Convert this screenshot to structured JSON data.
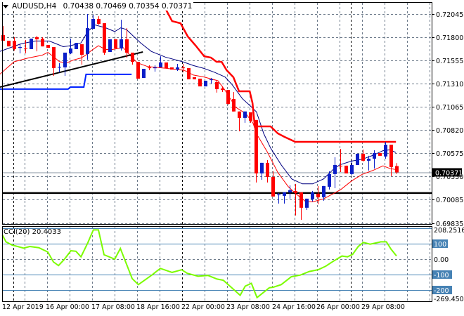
{
  "header": {
    "symbol": "AUDUSD,H4",
    "open": "0.70438",
    "high": "0.70469",
    "low": "0.70354",
    "close": "0.70371"
  },
  "colors": {
    "bull": "#0A1EC8",
    "bear": "#FF0000",
    "ma_upper": "#000080",
    "ma_lower": "#FF0000",
    "resistance": "#FF0000",
    "support": "#0022FF",
    "trendline": "#000000",
    "cci": "#7CFC00",
    "cci_levels": "#4682B4",
    "grid": "#6E7B8B"
  },
  "chart_data": [
    {
      "type": "candlestick",
      "title": "AUDUSD,H4",
      "ylim": [
        0.69835,
        0.7227
      ],
      "y_ticks": [
        "0.72045",
        "0.71800",
        "0.71555",
        "0.71310",
        "0.71065",
        "0.70820",
        "0.70575",
        "0.70330",
        "0.70085",
        "0.69835"
      ],
      "current_price": "0.70371",
      "x_labels": [
        "12 Apr 2019",
        "16 Apr 00:00",
        "17 Apr 08:00",
        "18 Apr 16:00",
        "22 Apr 00:00",
        "23 Apr 08:00",
        "24 Apr 16:00",
        "26 Apr 00:00",
        "29 Apr 08:00"
      ],
      "candles_ohlc": [
        [
          0.71822,
          0.71918,
          0.71763,
          0.71763
        ],
        [
          0.71763,
          0.71763,
          0.71703,
          0.71703
        ],
        [
          0.71763,
          0.718,
          0.71659,
          0.71674
        ],
        [
          0.71688,
          0.71726,
          0.71629,
          0.71696
        ],
        [
          0.71688,
          0.7177,
          0.71629,
          0.71681
        ],
        [
          0.71674,
          0.71785,
          0.71674,
          0.71785
        ],
        [
          0.718,
          0.71815,
          0.71651,
          0.71778
        ],
        [
          0.71785,
          0.718,
          0.71703,
          0.71703
        ],
        [
          0.71718,
          0.71718,
          0.71688,
          0.71688
        ],
        [
          0.71696,
          0.71696,
          0.71392,
          0.71473
        ],
        [
          0.71481,
          0.71525,
          0.71429,
          0.71488
        ],
        [
          0.71481,
          0.71637,
          0.71392,
          0.71637
        ],
        [
          0.71629,
          0.71785,
          0.71622,
          0.71681
        ],
        [
          0.71674,
          0.7174,
          0.71674,
          0.7174
        ],
        [
          0.71726,
          0.71726,
          0.7151,
          0.71614
        ],
        [
          0.71622,
          0.72045,
          0.71562,
          0.71896
        ],
        [
          0.71889,
          0.72037,
          0.71889,
          0.71993
        ],
        [
          0.71993,
          0.72022,
          0.71933,
          0.71941
        ],
        [
          0.71948,
          0.71948,
          0.71614,
          0.71637
        ],
        [
          0.71644,
          0.71778,
          0.71644,
          0.71778
        ],
        [
          0.71778,
          0.71778,
          0.71681,
          0.71681
        ],
        [
          0.71681,
          0.71985,
          0.71659,
          0.71778
        ],
        [
          0.71778,
          0.71896,
          0.71585,
          0.71637
        ],
        [
          0.71637,
          0.71637,
          0.7151,
          0.7154
        ],
        [
          0.7154,
          0.7154,
          0.71362,
          0.71362
        ],
        [
          0.71369,
          0.71466,
          0.71369,
          0.71466
        ],
        [
          0.71481,
          0.71503,
          0.71451,
          0.71473
        ],
        [
          0.71473,
          0.71503,
          0.71436,
          0.71481
        ],
        [
          0.71481,
          0.71599,
          0.71481,
          0.71533
        ],
        [
          0.71533,
          0.71533,
          0.71473,
          0.71473
        ],
        [
          0.71481,
          0.71481,
          0.71458,
          0.71458
        ],
        [
          0.71458,
          0.71518,
          0.71444,
          0.71481
        ],
        [
          0.71481,
          0.71518,
          0.71429,
          0.71473
        ],
        [
          0.71473,
          0.71473,
          0.71355,
          0.71355
        ],
        [
          0.71377,
          0.71377,
          0.71355,
          0.71355
        ],
        [
          0.71362,
          0.71362,
          0.7128,
          0.7128
        ],
        [
          0.7128,
          0.7134,
          0.7128,
          0.7134
        ],
        [
          0.71347,
          0.71369,
          0.7131,
          0.71355
        ],
        [
          0.71325,
          0.7134,
          0.71214,
          0.71251
        ],
        [
          0.71258,
          0.7128,
          0.71221,
          0.71243
        ],
        [
          0.71243,
          0.71243,
          0.71087,
          0.71095
        ],
        [
          0.71147,
          0.71221,
          0.71015,
          0.71015
        ],
        [
          0.71015,
          0.71015,
          0.70805,
          0.70947
        ],
        [
          0.70947,
          0.71015,
          0.70895,
          0.71015
        ],
        [
          0.71006,
          0.71006,
          0.70895,
          0.70917
        ],
        [
          0.70925,
          0.70925,
          0.70264,
          0.7036
        ],
        [
          0.7036,
          0.70472,
          0.70293,
          0.70472
        ],
        [
          0.70472,
          0.70501,
          0.70264,
          0.70323
        ],
        [
          0.70323,
          0.70383,
          0.70116,
          0.70116
        ],
        [
          0.7013,
          0.70153,
          0.70041,
          0.70138
        ],
        [
          0.70123,
          0.7016,
          0.70041,
          0.7016
        ],
        [
          0.7016,
          0.70234,
          0.70093,
          0.70182
        ],
        [
          0.70175,
          0.70249,
          0.69915,
          0.70153
        ],
        [
          0.7016,
          0.7016,
          0.6987,
          0.69997
        ],
        [
          0.69997,
          0.70093,
          0.69974,
          0.70093
        ],
        [
          0.70086,
          0.70175,
          0.70064,
          0.7016
        ],
        [
          0.70145,
          0.70227,
          0.70034,
          0.70108
        ],
        [
          0.70108,
          0.70227,
          0.70071,
          0.70227
        ],
        [
          0.70219,
          0.70383,
          0.7019,
          0.70353
        ],
        [
          0.70353,
          0.70531,
          0.70204,
          0.70449
        ],
        [
          0.70442,
          0.7062,
          0.70375,
          0.70435
        ],
        [
          0.70442,
          0.70442,
          0.7036,
          0.7036
        ],
        [
          0.70353,
          0.70494,
          0.70345,
          0.70449
        ],
        [
          0.70449,
          0.70568,
          0.70449,
          0.70568
        ],
        [
          0.70568,
          0.70612,
          0.70486,
          0.70494
        ],
        [
          0.70494,
          0.70546,
          0.7039,
          0.70516
        ],
        [
          0.70516,
          0.70605,
          0.70412,
          0.70575
        ],
        [
          0.70575,
          0.70575,
          0.70546,
          0.70546
        ],
        [
          0.70539,
          0.70694,
          0.70516,
          0.70664
        ],
        [
          0.70664,
          0.70664,
          0.70331,
          0.70427
        ],
        [
          0.70438,
          0.70469,
          0.70354,
          0.70371
        ]
      ],
      "ma_upper": [
        [
          -0.5,
          0.7165
        ],
        [
          3.25,
          0.7173
        ],
        [
          5.75,
          0.7176
        ],
        [
          8.25,
          0.7176
        ],
        [
          9.5,
          0.7173
        ],
        [
          10.75,
          0.717
        ],
        [
          12,
          0.7171
        ],
        [
          13.9,
          0.7174
        ],
        [
          15.1,
          0.7186
        ],
        [
          16.4,
          0.7193
        ],
        [
          18.25,
          0.719
        ],
        [
          19.9,
          0.7186
        ],
        [
          21,
          0.719
        ],
        [
          22,
          0.7188
        ],
        [
          23.25,
          0.7181
        ],
        [
          24.5,
          0.7174
        ],
        [
          26.4,
          0.7165
        ],
        [
          28.9,
          0.7159
        ],
        [
          32,
          0.7154
        ],
        [
          33.9,
          0.715
        ],
        [
          35.75,
          0.7147
        ],
        [
          37.6,
          0.7143
        ],
        [
          39.5,
          0.7138
        ],
        [
          40.75,
          0.713
        ],
        [
          42.6,
          0.7115
        ],
        [
          43.9,
          0.7108
        ],
        [
          45.1,
          0.7101
        ],
        [
          46.4,
          0.7078
        ],
        [
          47.6,
          0.7063
        ],
        [
          49.5,
          0.7045
        ],
        [
          51.4,
          0.703
        ],
        [
          53.25,
          0.7025
        ],
        [
          55.1,
          0.7025
        ],
        [
          57,
          0.703
        ],
        [
          58.9,
          0.7041
        ],
        [
          59.9,
          0.7045
        ],
        [
          62,
          0.7049
        ],
        [
          63.9,
          0.7051
        ],
        [
          65.75,
          0.7055
        ],
        [
          67.6,
          0.706
        ],
        [
          68.9,
          0.7061
        ],
        [
          69.9,
          0.7058
        ]
      ],
      "ma_lower": [
        [
          -0.5,
          0.7141
        ],
        [
          2,
          0.7154
        ],
        [
          4.5,
          0.7158
        ],
        [
          7,
          0.7161
        ],
        [
          8,
          0.7164
        ],
        [
          8.9,
          0.716
        ],
        [
          10.1,
          0.7154
        ],
        [
          11.4,
          0.7153
        ],
        [
          12.6,
          0.7156
        ],
        [
          13.9,
          0.7158
        ],
        [
          14.75,
          0.7161
        ],
        [
          15.75,
          0.7166
        ],
        [
          17,
          0.7171
        ],
        [
          18.25,
          0.7167
        ],
        [
          19.5,
          0.7167
        ],
        [
          21.4,
          0.7169
        ],
        [
          22.6,
          0.7161
        ],
        [
          23.9,
          0.7153
        ],
        [
          25.75,
          0.7149
        ],
        [
          27.6,
          0.7148
        ],
        [
          30.75,
          0.7146
        ],
        [
          32.25,
          0.7145
        ],
        [
          33.9,
          0.714
        ],
        [
          35.75,
          0.7138
        ],
        [
          38.25,
          0.7134
        ],
        [
          39.5,
          0.7124
        ],
        [
          41.4,
          0.7106
        ],
        [
          43.25,
          0.7099
        ],
        [
          44.5,
          0.7089
        ],
        [
          45.1,
          0.7078
        ],
        [
          47,
          0.7059
        ],
        [
          48.9,
          0.7037
        ],
        [
          50.75,
          0.7022
        ],
        [
          52,
          0.7015
        ],
        [
          53.9,
          0.7006
        ],
        [
          55.1,
          0.7006
        ],
        [
          57,
          0.7009
        ],
        [
          58.9,
          0.7015
        ],
        [
          60.1,
          0.7019
        ],
        [
          62,
          0.7028
        ],
        [
          63.9,
          0.7035
        ],
        [
          65.75,
          0.7039
        ],
        [
          67.6,
          0.7044
        ],
        [
          68.9,
          0.7041
        ],
        [
          70.1,
          0.704
        ]
      ],
      "resistance_step": [
        [
          25.9,
          0.72193
        ],
        [
          27,
          0.72104
        ],
        [
          28.9,
          0.72104
        ],
        [
          30.1,
          0.7197
        ],
        [
          31.6,
          0.71948
        ],
        [
          32.9,
          0.71807
        ],
        [
          34.3,
          0.71711
        ],
        [
          35.8,
          0.71599
        ],
        [
          37,
          0.71585
        ],
        [
          38,
          0.7154
        ],
        [
          38.9,
          0.7154
        ],
        [
          39.8,
          0.71451
        ],
        [
          41,
          0.71377
        ],
        [
          42,
          0.71228
        ],
        [
          43.9,
          0.71228
        ],
        [
          44.4,
          0.71102
        ],
        [
          44.8,
          0.70857
        ],
        [
          47.6,
          0.70857
        ],
        [
          48.9,
          0.70783
        ],
        [
          50.1,
          0.70746
        ],
        [
          52,
          0.70694
        ],
        [
          69.9,
          0.70694
        ]
      ],
      "support_step": [
        [
          -0.5,
          0.71251
        ],
        [
          11.6,
          0.71251
        ],
        [
          12,
          0.71273
        ],
        [
          14.4,
          0.71273
        ],
        [
          14.8,
          0.71407
        ],
        [
          22.9,
          0.71407
        ]
      ],
      "trendline": [
        [
          -0.5,
          0.71273
        ],
        [
          24.9,
          0.71644
        ]
      ],
      "horizontal_line": 0.70153
    },
    {
      "type": "line",
      "title": "CCI(20) 20.4033",
      "ylim": [
        -269.4509,
        208.2516
      ],
      "y_ticks": [
        "208.2516",
        "100",
        "0.00",
        "-100",
        "-200",
        "-269.4509"
      ],
      "levels": [
        200,
        100,
        -100,
        -200
      ],
      "series": [
        [
          -0.1,
          158
        ],
        [
          0.56,
          112
        ],
        [
          1.6,
          92
        ],
        [
          3.7,
          71
        ],
        [
          4.8,
          82
        ],
        [
          6.4,
          74
        ],
        [
          8,
          46
        ],
        [
          9,
          -18
        ],
        [
          9.9,
          -42
        ],
        [
          10.9,
          -3
        ],
        [
          12.1,
          54
        ],
        [
          13,
          51
        ],
        [
          13.9,
          15
        ],
        [
          15.1,
          105
        ],
        [
          16.1,
          189
        ],
        [
          17,
          189
        ],
        [
          18,
          28
        ],
        [
          19.9,
          0
        ],
        [
          20.9,
          69
        ],
        [
          23,
          -126
        ],
        [
          24.1,
          -165
        ],
        [
          26.5,
          -103
        ],
        [
          28,
          -60
        ],
        [
          30.1,
          -86
        ],
        [
          31.8,
          -69
        ],
        [
          32.8,
          -92
        ],
        [
          34.7,
          -111
        ],
        [
          36.5,
          -106
        ],
        [
          38.1,
          -129
        ],
        [
          39.2,
          -137
        ],
        [
          40.7,
          -185
        ],
        [
          42.2,
          -234
        ],
        [
          43.1,
          -175
        ],
        [
          44.2,
          -157
        ],
        [
          45.2,
          -249
        ],
        [
          47.4,
          -185
        ],
        [
          48.1,
          -182
        ],
        [
          49.5,
          -165
        ],
        [
          51.3,
          -114
        ],
        [
          52.9,
          -103
        ],
        [
          54.5,
          -80
        ],
        [
          56.1,
          -68
        ],
        [
          57.4,
          -46
        ],
        [
          58.7,
          -15
        ],
        [
          60.3,
          20
        ],
        [
          61.3,
          15
        ],
        [
          62.2,
          31
        ],
        [
          63.2,
          82
        ],
        [
          64.1,
          108
        ],
        [
          65.3,
          97
        ],
        [
          66.4,
          105
        ],
        [
          67.2,
          112
        ],
        [
          68.2,
          112
        ],
        [
          69,
          66
        ],
        [
          70,
          20.4
        ]
      ]
    }
  ]
}
